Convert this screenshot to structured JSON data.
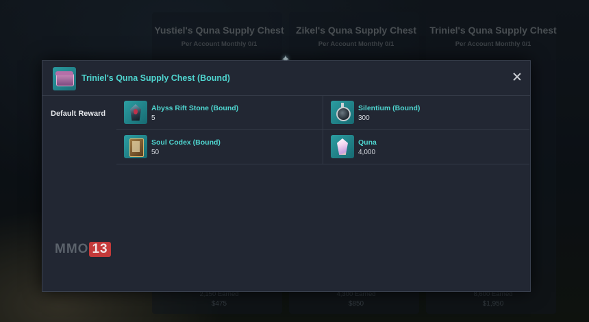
{
  "background": {
    "cards": [
      {
        "title": "Yustiel's Quna Supply Chest",
        "limit": "Per Account Monthly 0/1",
        "earned": "2,150 Earned",
        "price": "$475"
      },
      {
        "title": "Zikel's Quna Supply Chest",
        "limit": "Per Account Monthly 0/1",
        "earned": "4,300 Earned",
        "price": "$850"
      },
      {
        "title": "Triniel's Quna Supply Chest",
        "limit": "Per Account Monthly 0/1",
        "earned": "8,600 Earned",
        "price": "$1,950"
      }
    ]
  },
  "modal": {
    "title": "Triniel's Quna Supply Chest (Bound)",
    "icon": "chest-icon",
    "close_icon": "close-icon",
    "section_label": "Default Reward",
    "rewards": [
      {
        "name": "Abyss Rift Stone (Bound)",
        "qty": "5",
        "icon": "rift-stone-icon"
      },
      {
        "name": "Silentium (Bound)",
        "qty": "300",
        "icon": "silentium-icon"
      },
      {
        "name": "Soul Codex (Bound)",
        "qty": "50",
        "icon": "soul-codex-icon"
      },
      {
        "name": "Quna",
        "qty": "4,000",
        "icon": "quna-crystal-icon"
      }
    ]
  },
  "watermark": {
    "text": "MMO",
    "number": "13"
  },
  "colors": {
    "accent": "#4fd6d0",
    "modal_bg": "#222733",
    "watermark_badge": "#c43a3a"
  }
}
